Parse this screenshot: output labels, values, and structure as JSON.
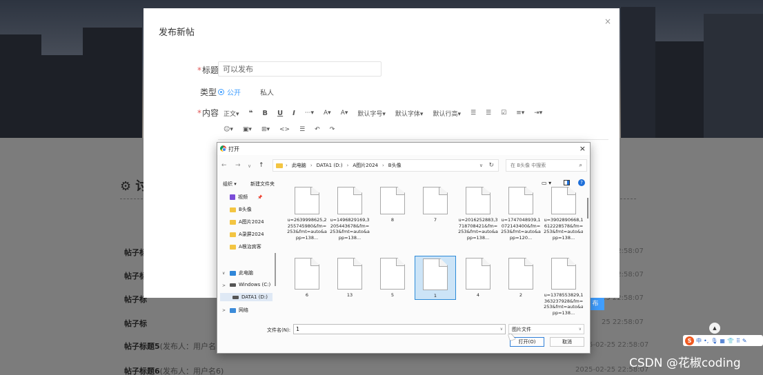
{
  "background": {
    "section_title": "⚙ 讨",
    "rows": [
      {
        "title": "帖子标",
        "sub": "",
        "date": "25 22:58:07"
      },
      {
        "title": "帖子标",
        "sub": "",
        "date": "25 22:58:07"
      },
      {
        "title": "帖子标",
        "sub": "",
        "date": "25 22:58:07"
      },
      {
        "title": "帖子标",
        "sub": "",
        "date": "25 22:58:07"
      },
      {
        "title": "帖子标题5",
        "sub": "(发布人：用户名5)",
        "date": "2025-02-25 22:58:07"
      },
      {
        "title": "帖子标题6",
        "sub": "(发布人：用户名6)",
        "date": "2025-02-25 22:58:07"
      }
    ],
    "publish_button": "布"
  },
  "modal": {
    "title": "发布新帖",
    "close": "×",
    "title_label": "标题",
    "title_value": "可以发布",
    "type_label": "类型",
    "type_options": [
      "公开",
      "私人"
    ],
    "type_selected": "公开",
    "content_label": "内容",
    "toolbar_row1": [
      "正文▾",
      "❝",
      "B",
      "U",
      "I",
      "···▾",
      "A▾",
      "A▾",
      "默认字号▾",
      "默认字体▾",
      "默认行高▾",
      "☰",
      "☰",
      "☑",
      "≡▾",
      "⇥▾"
    ],
    "toolbar_row2": [
      "☺▾",
      "▣▾",
      "⊞▾",
      "<>",
      "☰",
      "↶",
      "↷"
    ]
  },
  "file_dialog": {
    "title": "打开",
    "close": "×",
    "nav": {
      "back": "←",
      "forward": "→",
      "recent": "∨",
      "up": "↑"
    },
    "breadcrumb": [
      "此电脑",
      "DATA1 (D:)",
      "A图片2024",
      "B头像"
    ],
    "search_placeholder": "在 B头像 中搜索",
    "organize": "组织 ▾",
    "new_folder": "新建文件夹",
    "sidebar": [
      {
        "label": "视频",
        "icon": "video",
        "pinned": true
      },
      {
        "label": "B头像",
        "icon": "folder"
      },
      {
        "label": "A图片2024",
        "icon": "folder"
      },
      {
        "label": "A录屏2024",
        "icon": "folder"
      },
      {
        "label": "A根治宾客",
        "icon": "folder"
      },
      {
        "label": "此电脑",
        "icon": "pc",
        "expand": "∨"
      },
      {
        "label": "Windows (C:)",
        "icon": "drive",
        "expand": ">"
      },
      {
        "label": "DATA1 (D:)",
        "icon": "drive",
        "expand": ">",
        "selected": true
      },
      {
        "label": "网络",
        "icon": "network",
        "expand": ">"
      }
    ],
    "files_row1": [
      "u=2639998625,2255745980&fm=253&fmt=auto&app=138...",
      "u=1496829169,3205443678&fm=253&fmt=auto&app=138...",
      "8",
      "7",
      "u=2016252883,3718708421&fm=253&fmt=auto&app=138...",
      "u=1747048939,1072143400&fm=253&fmt=auto&app=120...",
      "u=3902890668,1612228578&fm=253&fmt=auto&app=138..."
    ],
    "files_row2": [
      "6",
      "13",
      "5",
      "1",
      "4",
      "2",
      "u=1378553829,1363237928&fm=253&fmt=auto&app=138..."
    ],
    "selected_file": "1",
    "filename_label": "文件名(N):",
    "filename_value": "1",
    "filetype": "图片文件",
    "open_button": "打开(O)",
    "cancel_button": "取消"
  },
  "overlay": {
    "scroll_top": "▲",
    "ime": {
      "logo": "S",
      "items": [
        "中",
        "•,",
        "🎙",
        "▦",
        "👕",
        "⠿",
        "✎"
      ]
    },
    "watermark": "CSDN @花椒coding"
  }
}
